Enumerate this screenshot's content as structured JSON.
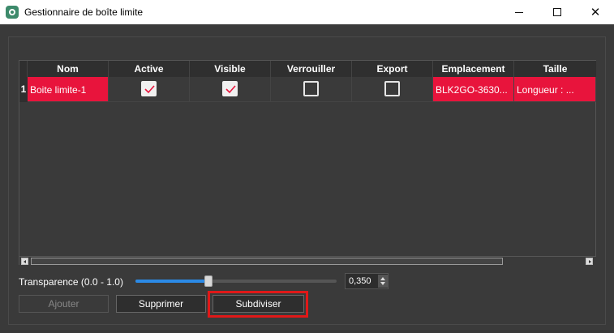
{
  "window": {
    "title": "Gestionnaire de boîte limite"
  },
  "window_controls": {
    "minimize": "",
    "maximize": "",
    "close": "✕"
  },
  "table": {
    "headers": [
      "Nom",
      "Active",
      "Visible",
      "Verrouiller",
      "Export",
      "Emplacement",
      "Taille"
    ],
    "rows": [
      {
        "index": "1",
        "nom": "Boite limite-1",
        "active": true,
        "visible": true,
        "verrouiller": false,
        "export": false,
        "emplacement": "BLK2GO-3630...",
        "taille": "Longueur : ..."
      }
    ]
  },
  "transparency": {
    "label": "Transparence (0.0 - 1.0)",
    "value": "0,350",
    "level": 0.35
  },
  "buttons": {
    "add": "Ajouter",
    "delete": "Supprimer",
    "subdivide": "Subdiviser"
  },
  "colors": {
    "selected_cell": "#e8143c",
    "checkmark": "#e8143c",
    "slider_fill": "#2b8ae6",
    "highlight": "#e01818"
  }
}
